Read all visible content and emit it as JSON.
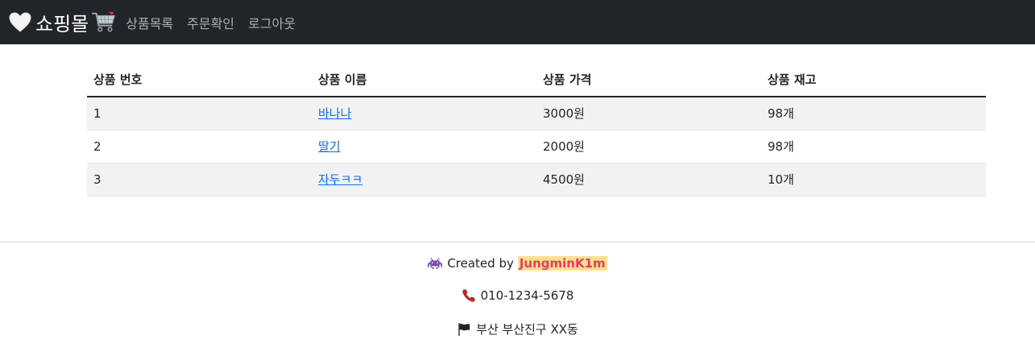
{
  "navbar": {
    "brand": {
      "heart_icon": "white-heart-icon",
      "title": "쇼핑몰",
      "cart_icon": "shopping-cart-icon"
    },
    "links": [
      {
        "label": "상품목록"
      },
      {
        "label": "주문확인"
      },
      {
        "label": "로그아웃"
      }
    ]
  },
  "table": {
    "headers": [
      "상품 번호",
      "상품 이름",
      "상품 가격",
      "상품 재고"
    ],
    "rows": [
      {
        "no": "1",
        "name": "바나나",
        "price": "3000원",
        "stock": "98개"
      },
      {
        "no": "2",
        "name": "딸기",
        "price": "2000원",
        "stock": "98개"
      },
      {
        "no": "3",
        "name": "자두ㅋㅋ",
        "price": "4500원",
        "stock": "10개"
      }
    ]
  },
  "footer": {
    "created_prefix": "Created by",
    "author": "JungminK1m",
    "author_icon": "space-invader-icon",
    "phone_icon": "telephone-icon",
    "phone": "010-1234-5678",
    "address_icon": "black-flag-icon",
    "address": "부산 부산진구 XX동"
  },
  "colors": {
    "navbar_bg": "#212529",
    "link": "#0d6efd",
    "author_text": "#e8396b",
    "author_highlight": "#ffe08a",
    "striped_row": "#f2f2f2"
  }
}
